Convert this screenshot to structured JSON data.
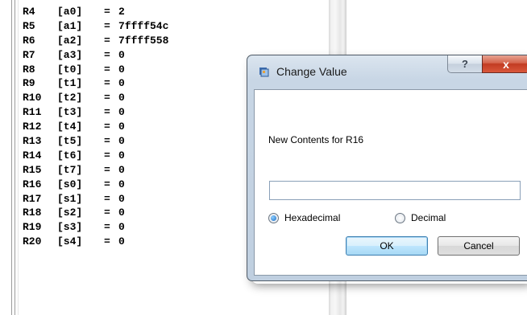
{
  "registers": [
    {
      "name": "R4",
      "alias": "[a0]",
      "value": "2"
    },
    {
      "name": "R5",
      "alias": "[a1]",
      "value": "7ffff54c"
    },
    {
      "name": "R6",
      "alias": "[a2]",
      "value": "7ffff558"
    },
    {
      "name": "R7",
      "alias": "[a3]",
      "value": "0"
    },
    {
      "name": "R8",
      "alias": "[t0]",
      "value": "0"
    },
    {
      "name": "R9",
      "alias": "[t1]",
      "value": "0"
    },
    {
      "name": "R10",
      "alias": "[t2]",
      "value": "0"
    },
    {
      "name": "R11",
      "alias": "[t3]",
      "value": "0"
    },
    {
      "name": "R12",
      "alias": "[t4]",
      "value": "0"
    },
    {
      "name": "R13",
      "alias": "[t5]",
      "value": "0"
    },
    {
      "name": "R14",
      "alias": "[t6]",
      "value": "0"
    },
    {
      "name": "R15",
      "alias": "[t7]",
      "value": "0"
    },
    {
      "name": "R16",
      "alias": "[s0]",
      "value": "0"
    },
    {
      "name": "R17",
      "alias": "[s1]",
      "value": "0"
    },
    {
      "name": "R18",
      "alias": "[s2]",
      "value": "0"
    },
    {
      "name": "R19",
      "alias": "[s3]",
      "value": "0"
    },
    {
      "name": "R20",
      "alias": "[s4]",
      "value": "0"
    }
  ],
  "equals_sign": "=",
  "dialog": {
    "title": "Change Value",
    "help_label": "?",
    "close_label": "x",
    "contents_label": "New Contents for R16",
    "input_value": "",
    "radio_hex_label": "Hexadecimal",
    "radio_dec_label": "Decimal",
    "radio_selected": "hex",
    "ok_label": "OK",
    "cancel_label": "Cancel"
  },
  "colors": {
    "dialog_frame": "#c8d6e5",
    "close_button": "#c23b22",
    "radio_fill": "#1b6cc5"
  }
}
